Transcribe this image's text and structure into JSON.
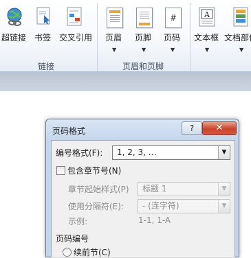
{
  "ribbon": {
    "buttons": [
      {
        "label": "超链接",
        "icon": "hyperlink-globe-icon"
      },
      {
        "label": "书签",
        "icon": "bookmark-icon"
      },
      {
        "label": "交叉引用",
        "icon": "cross-reference-icon"
      },
      {
        "label": "页眉",
        "icon": "header-icon"
      },
      {
        "label": "页脚",
        "icon": "footer-icon"
      },
      {
        "label": "页码",
        "icon": "page-number-icon"
      },
      {
        "label": "文本框",
        "icon": "text-box-icon"
      },
      {
        "label": "文档部件",
        "icon": "quick-parts-icon"
      }
    ],
    "groups": [
      {
        "label": "链接"
      },
      {
        "label": "页眉和页脚"
      }
    ],
    "header_glyph": "#",
    "textbox_glyph": "A"
  },
  "dialog": {
    "title": "页码格式",
    "help_label": "?",
    "close_label": "✕",
    "number_format_label": "编号格式(F):",
    "number_format_value": "1, 2, 3, …",
    "include_chapter_label": "包含章节号(N)",
    "chapter_style_label": "章节起始样式(P)",
    "chapter_style_value": "标题 1",
    "separator_label": "使用分隔符(E):",
    "separator_value": "-  (连字符)",
    "example_label": "示例:",
    "example_value": "1-1, 1-A",
    "page_numbering_label": "页码编号",
    "continue_label": "续前节(C)"
  },
  "colors": {
    "ribbon_border": "#aebfd6",
    "dialog_frame": "#c5d6ec",
    "close_button": "#c8442a"
  }
}
